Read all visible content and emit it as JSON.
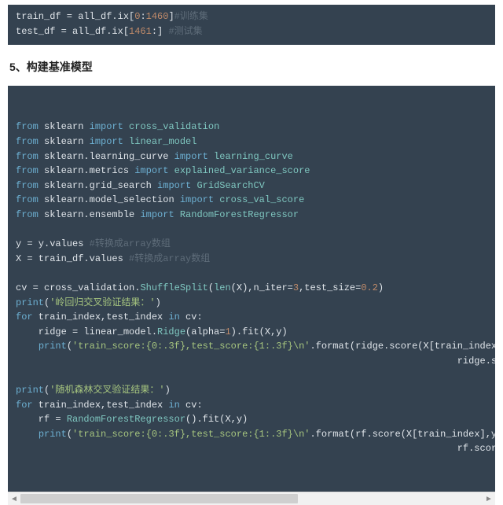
{
  "block1": {
    "lines": [
      [
        {
          "t": "train_df = all_df.ix[",
          "c": "tok-mod"
        },
        {
          "t": "0",
          "c": "tok-num"
        },
        {
          "t": ":",
          "c": "tok-mod"
        },
        {
          "t": "1460",
          "c": "tok-num"
        },
        {
          "t": "]",
          "c": "tok-mod"
        },
        {
          "t": "#训练集",
          "c": "tok-cmt"
        }
      ],
      [
        {
          "t": "test_df = all_df.ix[",
          "c": "tok-mod"
        },
        {
          "t": "1461",
          "c": "tok-num"
        },
        {
          "t": ":] ",
          "c": "tok-mod"
        },
        {
          "t": "#测试集",
          "c": "tok-cmt"
        }
      ]
    ]
  },
  "heading": "5、构建基准模型",
  "block2": {
    "lines": [
      [
        {
          "t": "from",
          "c": "tok-kw"
        },
        {
          "t": " sklearn ",
          "c": "tok-mod"
        },
        {
          "t": "import",
          "c": "tok-kw"
        },
        {
          "t": " cross_validation",
          "c": "tok-fn"
        }
      ],
      [
        {
          "t": "from",
          "c": "tok-kw"
        },
        {
          "t": " sklearn ",
          "c": "tok-mod"
        },
        {
          "t": "import",
          "c": "tok-kw"
        },
        {
          "t": " linear_model",
          "c": "tok-fn"
        }
      ],
      [
        {
          "t": "from",
          "c": "tok-kw"
        },
        {
          "t": " sklearn.learning_curve ",
          "c": "tok-mod"
        },
        {
          "t": "import",
          "c": "tok-kw"
        },
        {
          "t": " learning_curve",
          "c": "tok-fn"
        }
      ],
      [
        {
          "t": "from",
          "c": "tok-kw"
        },
        {
          "t": " sklearn.metrics ",
          "c": "tok-mod"
        },
        {
          "t": "import",
          "c": "tok-kw"
        },
        {
          "t": " explained_variance_score",
          "c": "tok-fn"
        }
      ],
      [
        {
          "t": "from",
          "c": "tok-kw"
        },
        {
          "t": " sklearn.grid_search ",
          "c": "tok-mod"
        },
        {
          "t": "import",
          "c": "tok-kw"
        },
        {
          "t": " GridSearchCV",
          "c": "tok-fn"
        }
      ],
      [
        {
          "t": "from",
          "c": "tok-kw"
        },
        {
          "t": " sklearn.model_selection ",
          "c": "tok-mod"
        },
        {
          "t": "import",
          "c": "tok-kw"
        },
        {
          "t": " cross_val_score",
          "c": "tok-fn"
        }
      ],
      [
        {
          "t": "from",
          "c": "tok-kw"
        },
        {
          "t": " sklearn.ensemble ",
          "c": "tok-mod"
        },
        {
          "t": "import",
          "c": "tok-kw"
        },
        {
          "t": " RandomForestRegressor",
          "c": "tok-fn"
        }
      ],
      [
        {
          "t": " ",
          "c": "tok-mod"
        }
      ],
      [
        {
          "t": "y = y.values ",
          "c": "tok-mod"
        },
        {
          "t": "#转换成array数组",
          "c": "tok-cmt"
        }
      ],
      [
        {
          "t": "X = train_df.values ",
          "c": "tok-mod"
        },
        {
          "t": "#转换成array数组",
          "c": "tok-cmt"
        }
      ],
      [
        {
          "t": " ",
          "c": "tok-mod"
        }
      ],
      [
        {
          "t": "cv = cross_validation.",
          "c": "tok-mod"
        },
        {
          "t": "ShuffleSplit",
          "c": "tok-fn"
        },
        {
          "t": "(",
          "c": "tok-mod"
        },
        {
          "t": "len",
          "c": "tok-fn"
        },
        {
          "t": "(X),n_iter=",
          "c": "tok-mod"
        },
        {
          "t": "3",
          "c": "tok-num"
        },
        {
          "t": ",test_size=",
          "c": "tok-mod"
        },
        {
          "t": "0.2",
          "c": "tok-num"
        },
        {
          "t": ")",
          "c": "tok-mod"
        }
      ],
      [
        {
          "t": "print",
          "c": "tok-kw"
        },
        {
          "t": "(",
          "c": "tok-mod"
        },
        {
          "t": "'岭回归交叉验证结果：'",
          "c": "tok-str"
        },
        {
          "t": ")",
          "c": "tok-mod"
        }
      ],
      [
        {
          "t": "for",
          "c": "tok-kw"
        },
        {
          "t": " train_index,test_index ",
          "c": "tok-mod"
        },
        {
          "t": "in",
          "c": "tok-kw"
        },
        {
          "t": " cv:",
          "c": "tok-mod"
        }
      ],
      [
        {
          "t": "    ridge = linear_model.",
          "c": "tok-mod"
        },
        {
          "t": "Ridge",
          "c": "tok-fn"
        },
        {
          "t": "(alpha=",
          "c": "tok-mod"
        },
        {
          "t": "1",
          "c": "tok-num"
        },
        {
          "t": ").fit(X,y)",
          "c": "tok-mod"
        }
      ],
      [
        {
          "t": "    ",
          "c": "tok-mod"
        },
        {
          "t": "print",
          "c": "tok-kw"
        },
        {
          "t": "(",
          "c": "tok-mod"
        },
        {
          "t": "'train_score:{0:.3f},test_score:{1:.3f}\\n'",
          "c": "tok-str"
        },
        {
          "t": ".format(ridge.score(X[train_index],y[train_index",
          "c": "tok-mod"
        }
      ],
      [
        {
          "t": "                                                                              ridge.score(",
          "c": "tok-mod"
        }
      ],
      [
        {
          "t": " ",
          "c": "tok-mod"
        }
      ],
      [
        {
          "t": "print",
          "c": "tok-kw"
        },
        {
          "t": "(",
          "c": "tok-mod"
        },
        {
          "t": "'随机森林交叉验证结果：'",
          "c": "tok-str"
        },
        {
          "t": ")",
          "c": "tok-mod"
        }
      ],
      [
        {
          "t": "for",
          "c": "tok-kw"
        },
        {
          "t": " train_index,test_index ",
          "c": "tok-mod"
        },
        {
          "t": "in",
          "c": "tok-kw"
        },
        {
          "t": " cv:",
          "c": "tok-mod"
        }
      ],
      [
        {
          "t": "    rf = ",
          "c": "tok-mod"
        },
        {
          "t": "RandomForestRegressor",
          "c": "tok-fn"
        },
        {
          "t": "().fit(X,y)",
          "c": "tok-mod"
        }
      ],
      [
        {
          "t": "    ",
          "c": "tok-mod"
        },
        {
          "t": "print",
          "c": "tok-kw"
        },
        {
          "t": "(",
          "c": "tok-mod"
        },
        {
          "t": "'train_score:{0:.3f},test_score:{1:.3f}\\n'",
          "c": "tok-str"
        },
        {
          "t": ".format(rf.score(X[train_index],y[train_index]),",
          "c": "tok-mod"
        }
      ],
      [
        {
          "t": "                                                                              rf.score(X[t",
          "c": "tok-mod"
        }
      ]
    ]
  }
}
